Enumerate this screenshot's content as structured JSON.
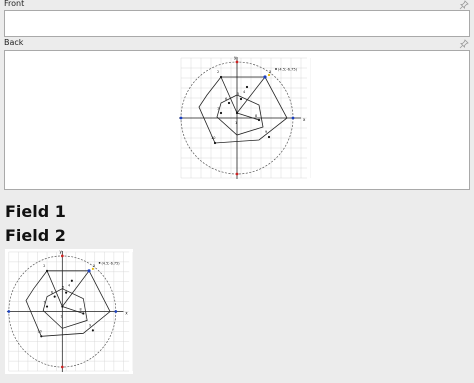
{
  "editor": {
    "front": {
      "label": "Front",
      "value": "",
      "pin_icon": "pin-icon"
    },
    "back": {
      "label": "Back",
      "pin_icon": "pin-icon"
    }
  },
  "preview": {
    "field1_label": "Field 1",
    "field2_label": "Field 2"
  },
  "diagram": {
    "axis_x_label": "x",
    "axis_y_label": "y",
    "coordinate_readout": "(4.5;-6.75)",
    "point_labels": [
      "1",
      "2",
      "3",
      "4",
      "5",
      "6",
      "7",
      "8",
      "9",
      "10"
    ],
    "colors": {
      "dashed_circle": "#555555",
      "grid": "#d0d0d0",
      "marker_red": "#cc2222",
      "marker_blue": "#1a3fbf",
      "marker_yellow": "#e6b800"
    }
  }
}
